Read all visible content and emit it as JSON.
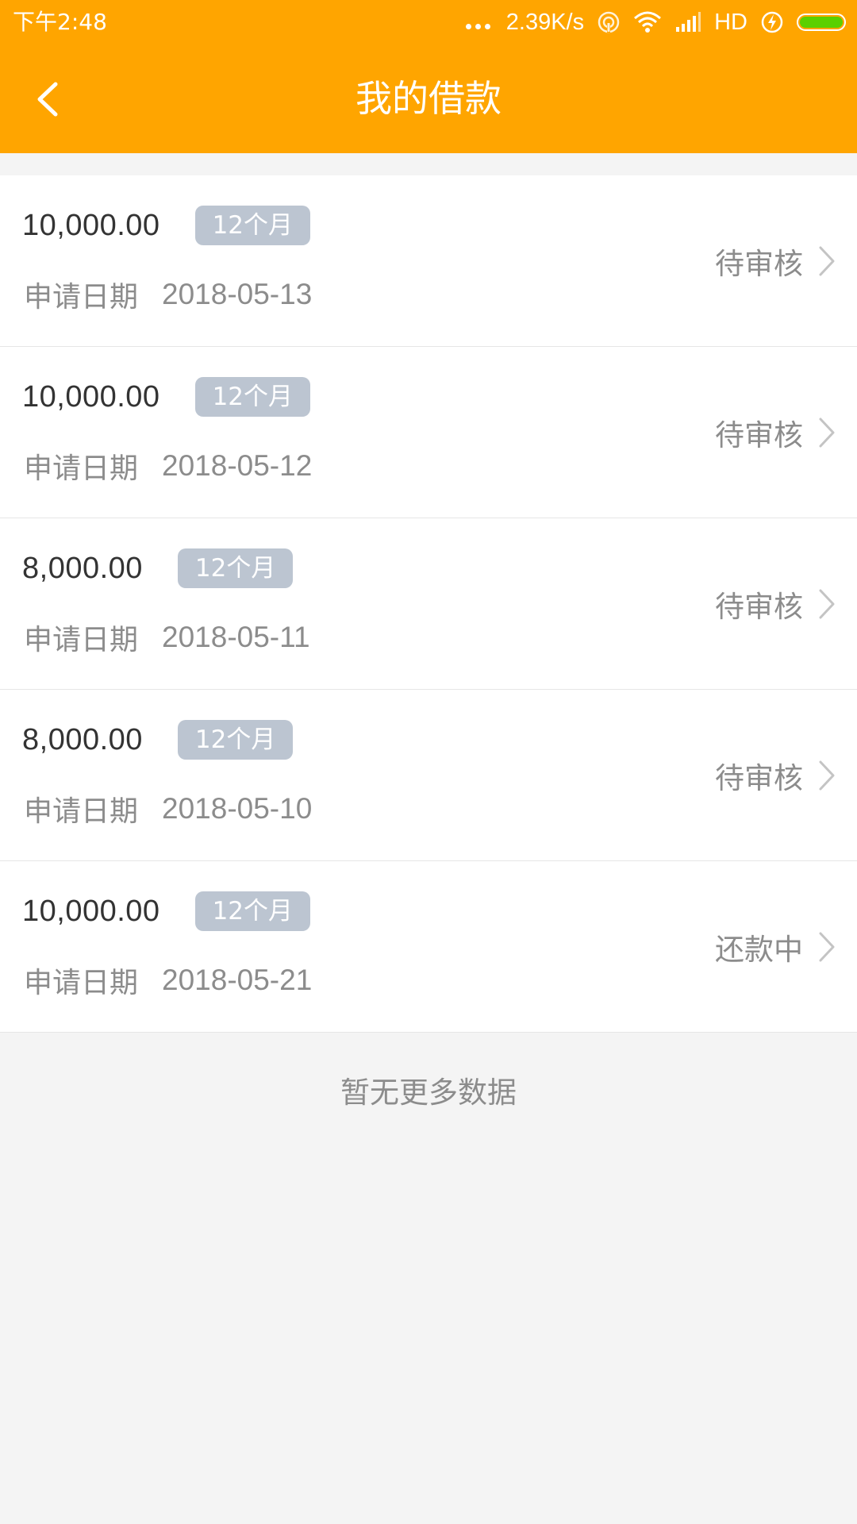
{
  "status_bar": {
    "time": "下午2:48",
    "net_speed": "2.39K/s",
    "network_type": "HD",
    "battery_color": "#5ad000",
    "icons": [
      "more-dots-icon",
      "hotspot-icon",
      "wifi-icon",
      "signal-icon",
      "charging-icon",
      "battery-icon"
    ]
  },
  "header": {
    "title": "我的借款",
    "back_icon": "chevron-left-icon",
    "color": "#FFA500"
  },
  "loans": [
    {
      "amount": "10,000.00",
      "term": "12个月",
      "date_label": "申请日期",
      "date": "2018-05-13",
      "status": "待审核"
    },
    {
      "amount": "10,000.00",
      "term": "12个月",
      "date_label": "申请日期",
      "date": "2018-05-12",
      "status": "待审核"
    },
    {
      "amount": "8,000.00",
      "term": "12个月",
      "date_label": "申请日期",
      "date": "2018-05-11",
      "status": "待审核"
    },
    {
      "amount": "8,000.00",
      "term": "12个月",
      "date_label": "申请日期",
      "date": "2018-05-10",
      "status": "待审核"
    },
    {
      "amount": "10,000.00",
      "term": "12个月",
      "date_label": "申请日期",
      "date": "2018-05-21",
      "status": "还款中"
    }
  ],
  "footer": {
    "no_more_text": "暂无更多数据"
  }
}
